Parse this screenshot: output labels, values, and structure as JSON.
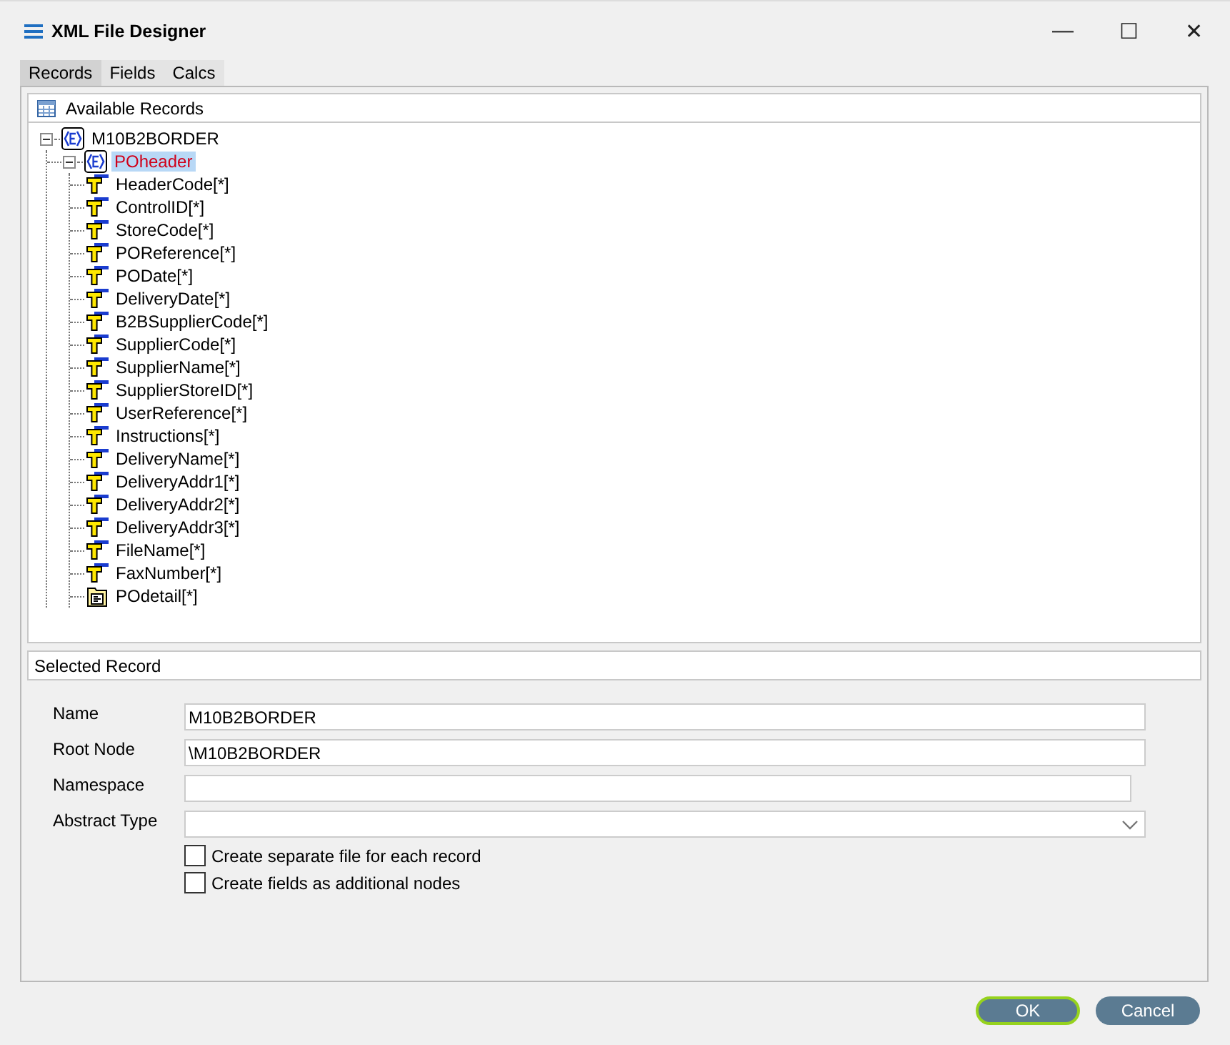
{
  "window": {
    "title": "XML File Designer",
    "controls": [
      "—",
      "☐",
      "✕"
    ]
  },
  "tabs": [
    {
      "label": "Records",
      "selected": true
    },
    {
      "label": "Fields",
      "selected": false
    },
    {
      "label": "Calcs",
      "selected": false
    }
  ],
  "available_records": {
    "title": "Available Records",
    "tree": [
      {
        "label": "M10B2BORDER",
        "kind": "element",
        "expanded": true,
        "selected": false,
        "children": [
          {
            "label": "POheader",
            "kind": "element",
            "expanded": true,
            "selected": true,
            "children": [
              {
                "label": "HeaderCode[*]",
                "kind": "field",
                "selected": false
              },
              {
                "label": "ControlID[*]",
                "kind": "field",
                "selected": false
              },
              {
                "label": "StoreCode[*]",
                "kind": "field",
                "selected": false
              },
              {
                "label": "POReference[*]",
                "kind": "field",
                "selected": false
              },
              {
                "label": "PODate[*]",
                "kind": "field",
                "selected": false
              },
              {
                "label": "DeliveryDate[*]",
                "kind": "field",
                "selected": false
              },
              {
                "label": "B2BSupplierCode[*]",
                "kind": "field",
                "selected": false
              },
              {
                "label": "SupplierCode[*]",
                "kind": "field",
                "selected": false
              },
              {
                "label": "SupplierName[*]",
                "kind": "field",
                "selected": false
              },
              {
                "label": "SupplierStoreID[*]",
                "kind": "field",
                "selected": false
              },
              {
                "label": "UserReference[*]",
                "kind": "field",
                "selected": false
              },
              {
                "label": "Instructions[*]",
                "kind": "field",
                "selected": false
              },
              {
                "label": "DeliveryName[*]",
                "kind": "field",
                "selected": false
              },
              {
                "label": "DeliveryAddr1[*]",
                "kind": "field",
                "selected": false
              },
              {
                "label": "DeliveryAddr2[*]",
                "kind": "field",
                "selected": false
              },
              {
                "label": "DeliveryAddr3[*]",
                "kind": "field",
                "selected": false
              },
              {
                "label": "FileName[*]",
                "kind": "field",
                "selected": false
              },
              {
                "label": "FaxNumber[*]",
                "kind": "field",
                "selected": false
              },
              {
                "label": "POdetail[*]",
                "kind": "table",
                "selected": false
              }
            ]
          }
        ]
      }
    ]
  },
  "selected_record": {
    "title": "Selected Record",
    "fields": [
      {
        "label": "Name",
        "kind": "text",
        "value": "M10B2BORDER"
      },
      {
        "label": "Root Node",
        "kind": "text",
        "value": "\\M10B2BORDER"
      },
      {
        "label": "Namespace",
        "kind": "short"
      },
      {
        "label": "Abstract Type",
        "kind": "dropdown"
      }
    ],
    "options": [
      {
        "label": "Create separate file for each record",
        "checked": false
      },
      {
        "label": "Create fields as additional nodes",
        "checked": false
      }
    ]
  },
  "buttons": [
    {
      "label": "OK",
      "default": true
    },
    {
      "label": "Cancel",
      "default": false
    }
  ]
}
